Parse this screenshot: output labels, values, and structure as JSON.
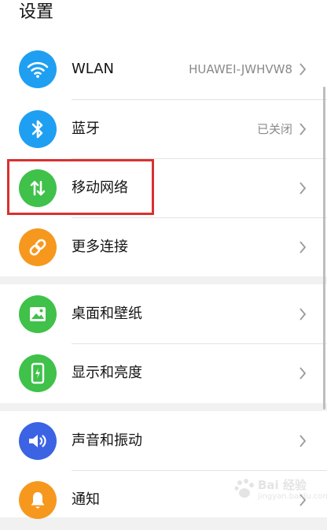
{
  "header": {
    "title": "设置"
  },
  "colors": {
    "wlan": "#1e9ff2",
    "bluetooth": "#1e9ff2",
    "mobile": "#3fc14a",
    "more": "#f6981e",
    "wallpaper": "#3fc14a",
    "display": "#3fc14a",
    "sound": "#3b63e3",
    "notify": "#f6981e",
    "highlight": "#d9312f"
  },
  "items": [
    {
      "label": "WLAN",
      "value": "HUAWEI-JWHVW8",
      "icon": "wifi-icon"
    },
    {
      "label": "蓝牙",
      "value": "已关闭",
      "icon": "bluetooth-icon"
    },
    {
      "label": "移动网络",
      "value": "",
      "icon": "mobile-data-icon"
    },
    {
      "label": "更多连接",
      "value": "",
      "icon": "link-icon"
    },
    {
      "label": "桌面和壁纸",
      "value": "",
      "icon": "image-icon"
    },
    {
      "label": "显示和亮度",
      "value": "",
      "icon": "phone-brightness-icon"
    },
    {
      "label": "声音和振动",
      "value": "",
      "icon": "speaker-icon"
    },
    {
      "label": "通知",
      "value": "",
      "icon": "bell-icon"
    }
  ],
  "watermark": {
    "text": "Bai 经验",
    "url": "jingyan.baidu.com"
  }
}
